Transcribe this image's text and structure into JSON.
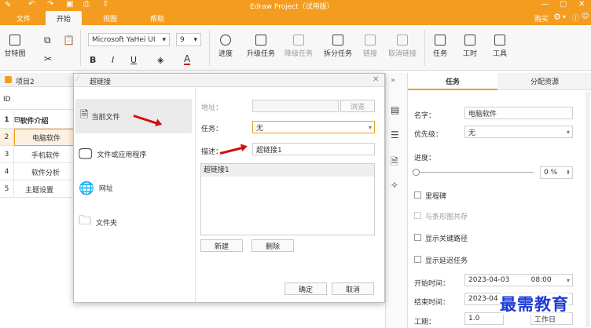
{
  "app": {
    "title": "Edraw Project（试用版）",
    "buy": "购买"
  },
  "tabs": [
    {
      "label": "文件"
    },
    {
      "label": "开始"
    },
    {
      "label": "视图"
    },
    {
      "label": "帮助"
    }
  ],
  "ribbon": {
    "gantt": "甘特图",
    "font_family": "Microsoft YaHei UI",
    "font_size": "9",
    "bold": "B",
    "italic": "I",
    "underline": "U",
    "font_color_glyph": "A",
    "progress": "进度",
    "upgrade": "升级任务",
    "downgrade": "降级任务",
    "split": "拆分任务",
    "link": "链接",
    "unlink": "取消链接",
    "task": "任务",
    "workday": "工时",
    "tools": "工具"
  },
  "grid": {
    "project_tab": "项目2",
    "id_header": "ID",
    "rows": [
      {
        "id": "1",
        "name": "软件介绍"
      },
      {
        "id": "2",
        "name": "电脑软件"
      },
      {
        "id": "3",
        "name": "手机软件"
      },
      {
        "id": "4",
        "name": "软件分析"
      },
      {
        "id": "5",
        "name": "主题设置"
      }
    ]
  },
  "dialog": {
    "title": "超链接",
    "nav": [
      {
        "label": "当前文件"
      },
      {
        "label": "文件或应用程序"
      },
      {
        "label": "网址"
      },
      {
        "label": "文件夹"
      }
    ],
    "address_label": "地址：",
    "address_value": "",
    "browse": "浏览",
    "task_label": "任务：",
    "task_value": "无",
    "desc_label": "描述：",
    "desc_value": "超链接1",
    "list_items": [
      "超链接1"
    ],
    "new": "新建",
    "delete": "删除",
    "ok": "确定",
    "cancel": "取消"
  },
  "panel": {
    "tab_task": "任务",
    "tab_resource": "分配资源",
    "name_label": "名字：",
    "name_value": "电脑软件",
    "priority_label": "优先级：",
    "priority_value": "无",
    "progress_label": "进度：",
    "progress_value": "0 %",
    "milestone": "里程碑",
    "share_bar": "与条形图共存",
    "critical": "显示关键路径",
    "delay": "显示延迟任务",
    "start_label": "开始时间：",
    "start_date": "2023-04-03",
    "start_time": "08:00",
    "end_label": "结束时间：",
    "end_date": "2023-04",
    "duration_label": "工期：",
    "duration_value": "1.0",
    "duration_unit": "工作日"
  },
  "watermark": "最需教育",
  "colors": {
    "accent": "#f39c1f",
    "arrow": "#d01010",
    "watermark": "#1f3bd6"
  }
}
